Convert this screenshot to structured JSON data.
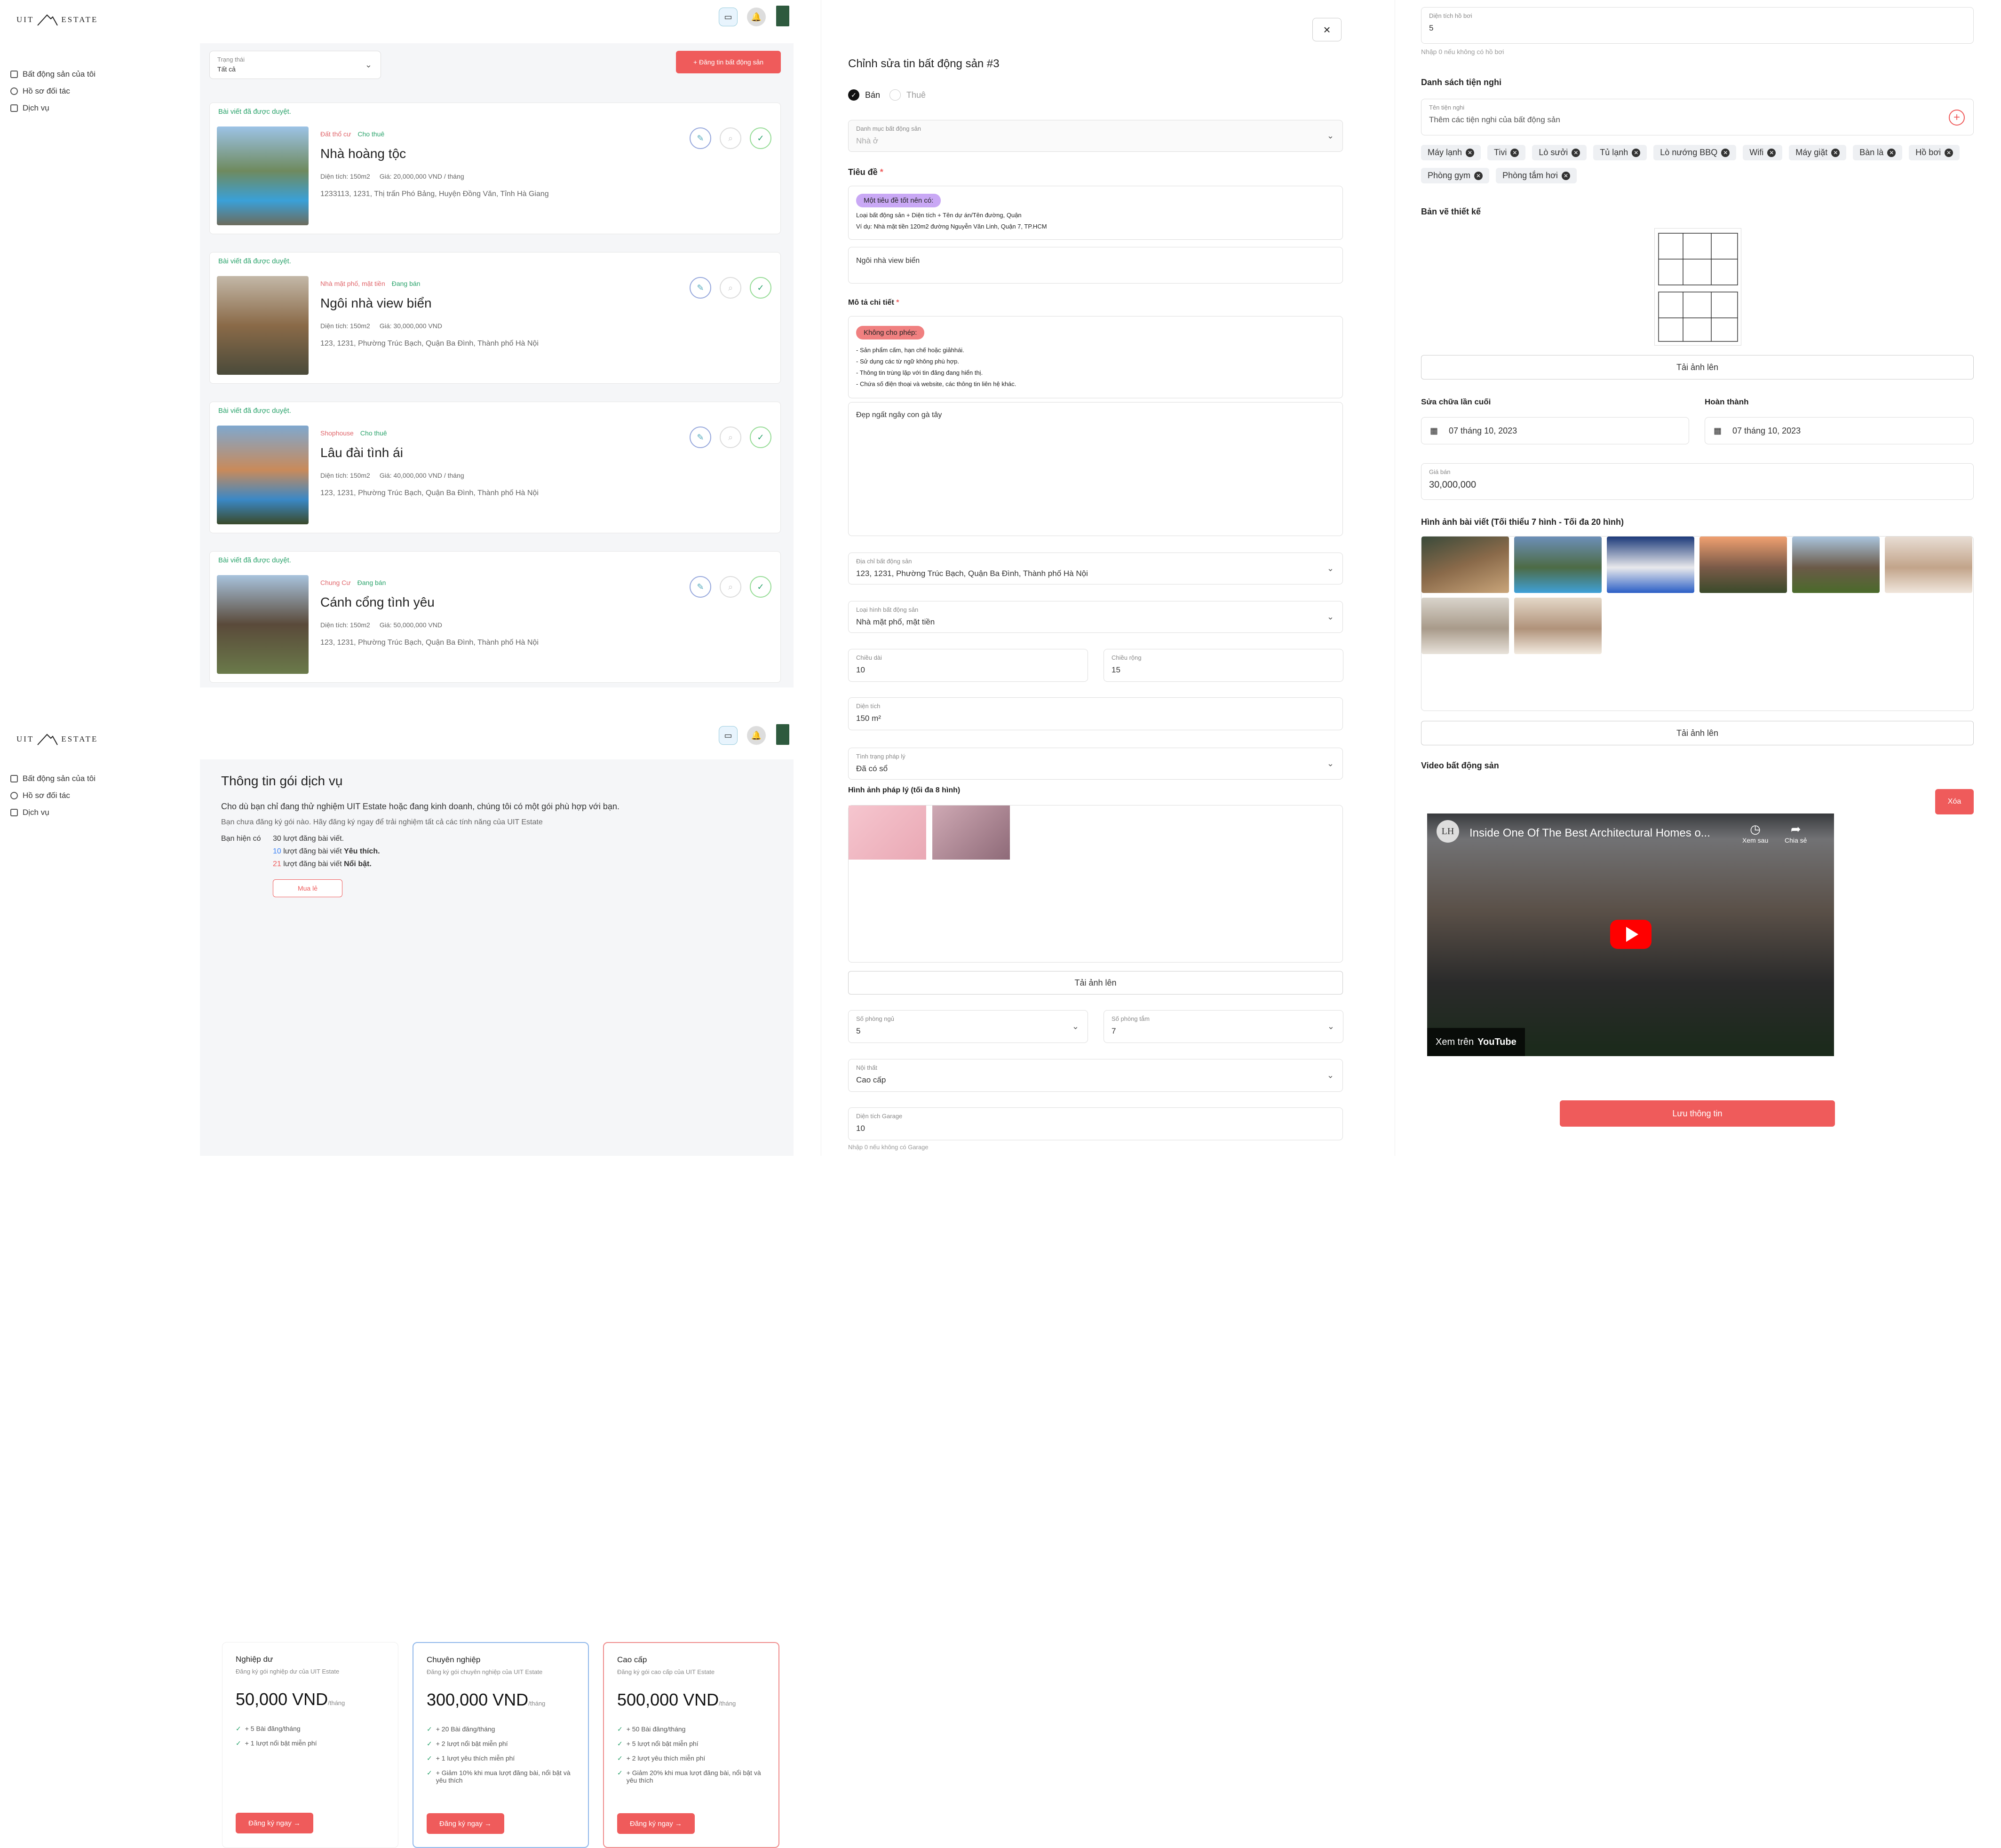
{
  "brand": {
    "left": "UIT",
    "right": "ESTATE"
  },
  "sidebar": {
    "items": [
      "Bất động sản của tôi",
      "Hồ sơ đối tác",
      "Dịch vụ"
    ]
  },
  "listing": {
    "filter_label": "Trạng thái",
    "filter_value": "Tất cả",
    "post_button": "+ Đăng tin bất động sản",
    "cards": [
      {
        "status": "Bài viết đã được duyệt.",
        "tag1": "Đất thổ cư",
        "tag2": "Cho thuê",
        "title": "Nhà hoàng tộc",
        "area": "Diện tích: 150m2",
        "price": "Giá: 20,000,000 VND / tháng",
        "address": "1233113, 1231, Thị trấn Phó Bảng, Huyện Đồng Văn, Tỉnh Hà Giang"
      },
      {
        "status": "Bài viết đã được duyệt.",
        "tag1": "Nhà mặt phố, mặt tiền",
        "tag2": "Đang bán",
        "title": "Ngôi nhà view biển",
        "area": "Diện tích: 150m2",
        "price": "Giá: 30,000,000 VND",
        "address": "123, 1231, Phường Trúc Bạch, Quận Ba Đình, Thành phố Hà Nội"
      },
      {
        "status": "Bài viết đã được duyệt.",
        "tag1": "Shophouse",
        "tag2": "Cho thuê",
        "title": "Lâu đài tình ái",
        "area": "Diện tích: 150m2",
        "price": "Giá: 40,000,000 VND / tháng",
        "address": "123, 1231, Phường Trúc Bạch, Quận Ba Đình, Thành phố Hà Nội"
      },
      {
        "status": "Bài viết đã được duyệt.",
        "tag1": "Chung Cư",
        "tag2": "Đang bán",
        "title": "Cánh cổng tình yêu",
        "area": "Diện tích: 150m2",
        "price": "Giá: 50,000,000 VND",
        "address": "123, 1231, Phường Trúc Bạch, Quận Ba Đình, Thành phố Hà Nội"
      }
    ]
  },
  "service": {
    "title": "Thông tin gói dịch vụ",
    "intro": "Cho dù bạn chỉ đang thử nghiệm UIT Estate hoặc đang kinh doanh, chúng tôi có một gói phù hợp với bạn.",
    "sub": "Bạn chưa đăng ký gói nào. Hãy đăng ký ngay để trải nghiệm tất cả các tính năng của UIT Estate",
    "have": "Bạn hiện có",
    "l1n": "30",
    "l1t": "lượt đăng bài viết.",
    "l2n": "10",
    "l2t": "lượt đăng bài viết",
    "l2b": "Yêu thích.",
    "l3n": "21",
    "l3t": "lượt đăng bài viết",
    "l3b": "Nổi bật.",
    "buy_more": "Mua lẻ",
    "packages": [
      {
        "name": "Nghiệp dư",
        "desc": "Đăng ký gói nghiệp dư của UIT Estate",
        "price": "50,000 VND",
        "unit": "/tháng",
        "features": [
          "+ 5 Bài đăng/tháng",
          "+ 1 lượt nổi bật miễn phí"
        ],
        "cta": "Đăng ký ngay"
      },
      {
        "name": "Chuyên nghiệp",
        "desc": "Đăng ký gói chuyên nghiệp của UIT Estate",
        "price": "300,000 VND",
        "unit": "/tháng",
        "features": [
          "+ 20 Bài đăng/tháng",
          "+ 2 lượt nổi bật miễn phí",
          "+ 1 lượt yêu thích miễn phí",
          "+ Giảm 10% khi mua lượt đăng bài, nổi bật và yêu thích"
        ],
        "cta": "Đăng ký ngay"
      },
      {
        "name": "Cao cấp",
        "desc": "Đăng ký gói cao cấp của UIT Estate",
        "price": "500,000 VND",
        "unit": "/tháng",
        "features": [
          "+ 50 Bài đăng/tháng",
          "+ 5 lượt nổi bật miễn phí",
          "+ 2 lượt yêu thích miễn phí",
          "+ Giảm 20% khi mua lượt đăng bài, nổi bật và yêu thích"
        ],
        "cta": "Đăng ký ngay"
      }
    ]
  },
  "edit": {
    "heading": "Chỉnh sửa tin bất động sản #3",
    "sell": "Bán",
    "rent": "Thuê",
    "category_label": "Danh mục bất động sản",
    "category_value": "Nhà ở",
    "title_label": "Tiêu đề",
    "title_hint_badge": "Một tiêu đề tốt nên có:",
    "title_hint1": "Loại bất động sản + Diện tích + Tên dự án/Tên đường, Quận",
    "title_hint2": "Ví dụ: Nhà mặt tiền 120m2 đường Nguyễn Văn Linh, Quận 7, TP.HCM",
    "title_value": "Ngôi nhà view biển",
    "desc_label": "Mô tả chi tiết",
    "desc_badge": "Không cho phép:",
    "desc_rules": [
      "- Sản phẩm cấm, hạn chế hoặc giảhhái.",
      "- Sử dụng các từ ngữ không phù hợp.",
      "- Thông tin trùng lặp với tin đăng đang hiển thị.",
      "- Chứa số điện thoại và website, các thông tin liên hệ khác."
    ],
    "desc_value": "Đẹp ngất ngây con gà tây",
    "addr_label": "Địa chỉ bất động sản",
    "addr_value": "123, 1231, Phường Trúc Bạch, Quận Ba Đình, Thành phố Hà Nội",
    "type_label": "Loại hình bất động sản",
    "type_value": "Nhà mặt phố, mặt tiền",
    "len_label": "Chiều dài",
    "len_value": "10",
    "wid_label": "Chiều rộng",
    "wid_value": "15",
    "area_label": "Diện tích",
    "area_value": "150  m²",
    "legal_label": "Tình trạng pháp lý",
    "legal_value": "Đã có sổ",
    "legal_img_label": "Hình ảnh pháp lý (tối đa 8 hình)",
    "upload": "Tải ảnh lên",
    "bed_label": "Số phòng ngủ",
    "bed_value": "5",
    "bath_label": "Số phòng tắm",
    "bath_value": "7",
    "furn_label": "Nội thất",
    "furn_value": "Cao cấp",
    "garage_label": "Diện tích Garage",
    "garage_value": "10",
    "garage_note": "Nhập 0 nếu không có Garage"
  },
  "edit2": {
    "pool_label": "Diện tích hồ bơi",
    "pool_value": "5",
    "pool_note": "Nhập 0 nếu không có hồ bơi",
    "amen_heading": "Danh sách tiện nghi",
    "amen_label": "Tên tiện nghi",
    "amen_placeholder": "Thêm các tiện nghi của bất động sản",
    "amenities": [
      "Máy lạnh",
      "Tivi",
      "Lò sưởi",
      "Tủ lạnh",
      "Lò nướng BBQ",
      "Wifi",
      "Máy giặt",
      "Bàn là",
      "Hồ bơi",
      "Phòng gym",
      "Phòng tắm hơi"
    ],
    "plan_heading": "Bản vẽ thiết kế",
    "upload": "Tải ảnh lên",
    "repair_label": "Sửa chữa lần cuối",
    "repair_value": "07 tháng 10, 2023",
    "done_label": "Hoàn thành",
    "done_value": "07 tháng 10, 2023",
    "price_label": "Giá bán",
    "price_value": "30,000,000",
    "imgs_heading": "Hình ảnh bài viết (Tối thiểu 7 hình - Tối đa 20 hình)",
    "video_heading": "Video bất động sản",
    "delete": "Xóa",
    "video_title": "Inside One Of The Best Architectural Homes o...",
    "watch_later": "Xem sau",
    "share": "Chia sẻ",
    "watch_on": "Xem trên",
    "yt": "YouTube",
    "save": "Lưu thông tin"
  },
  "colors": {
    "accent": "#ef5b5b",
    "ok": "#2aa36b",
    "blue": "#3b82f6"
  }
}
